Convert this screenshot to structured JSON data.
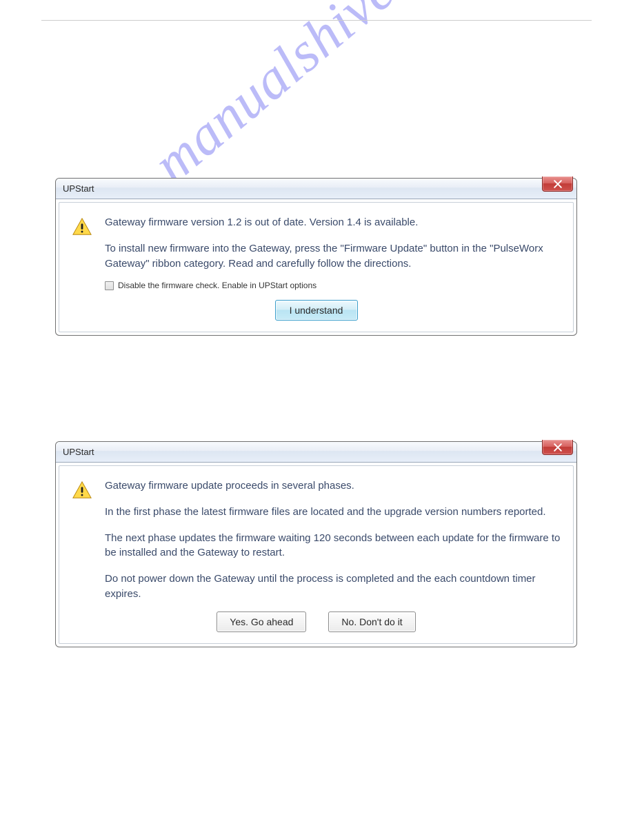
{
  "watermark": "manualshive.com",
  "dialog1": {
    "title": "UPStart",
    "line1": "Gateway firmware version 1.2 is out of date. Version 1.4 is available.",
    "line2": "To install new firmware into the Gateway, press the \"Firmware Update\" button in the \"PulseWorx Gateway\" ribbon category. Read and carefully follow the directions.",
    "checkbox_label": "Disable the firmware check. Enable in UPStart options",
    "ok_label": "I understand"
  },
  "dialog2": {
    "title": "UPStart",
    "line1": "Gateway firmware update proceeds in several phases.",
    "line2": "In the first phase the latest firmware files are located and the upgrade version numbers reported.",
    "line3": "The next phase updates the firmware waiting 120 seconds between each update for the firmware to be installed and the Gateway to restart.",
    "line4": "Do not power down the Gateway until the process is completed and the each countdown timer expires.",
    "yes_label": "Yes. Go ahead",
    "no_label": "No. Don't do it"
  }
}
